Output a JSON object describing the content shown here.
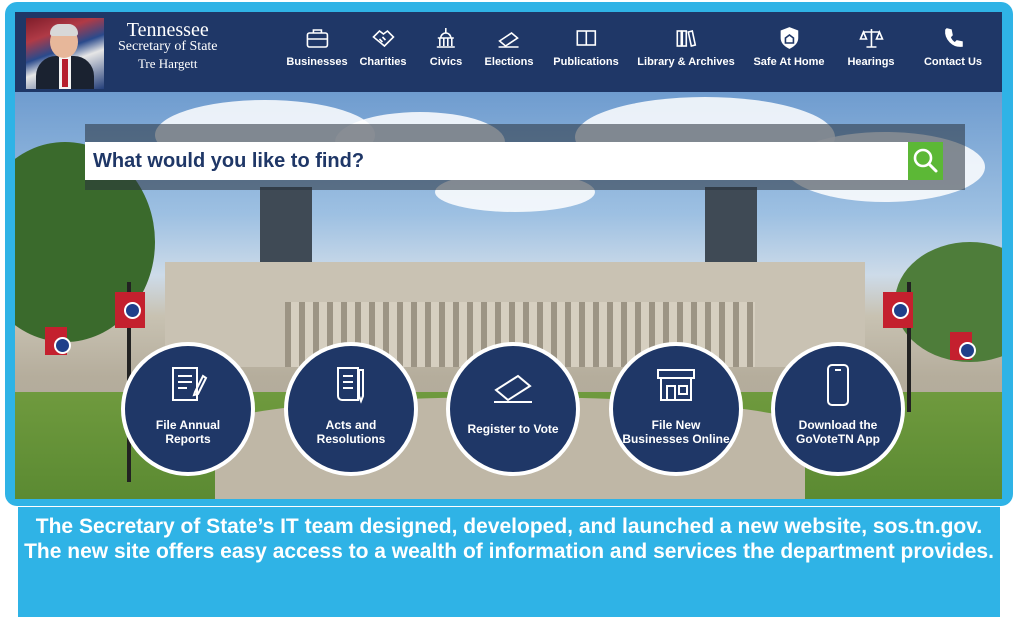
{
  "colors": {
    "navy": "#1f3767",
    "frame_blue": "#2fb3e6",
    "search_green": "#5cb836",
    "white": "#ffffff"
  },
  "header": {
    "title": "Tennessee",
    "subtitle": "Secretary of State",
    "name": "Tre Hargett",
    "nav": [
      {
        "label": "Businesses",
        "icon": "briefcase-icon"
      },
      {
        "label": "Charities",
        "icon": "handshake-icon"
      },
      {
        "label": "Civics",
        "icon": "capitol-icon"
      },
      {
        "label": "Elections",
        "icon": "vote-ballot-icon"
      },
      {
        "label": "Publications",
        "icon": "book-icon"
      },
      {
        "label": "Library & Archives",
        "icon": "books-icon"
      },
      {
        "label": "Safe At Home",
        "icon": "shield-icon"
      },
      {
        "label": "Hearings",
        "icon": "scales-icon"
      },
      {
        "label": "Contact Us",
        "icon": "phone-icon"
      }
    ]
  },
  "search": {
    "placeholder": "What would you like to find?",
    "button_icon": "search-icon"
  },
  "tiles": [
    {
      "label": "File Annual Reports",
      "icon": "document-pen-icon"
    },
    {
      "label": "Acts and Resolutions",
      "icon": "scroll-pen-icon"
    },
    {
      "label": "Register to Vote",
      "icon": "vote-ballot-icon"
    },
    {
      "label": "File New Businesses Online",
      "icon": "storefront-icon"
    },
    {
      "label": "Download the GoVoteTN App",
      "icon": "smartphone-icon"
    }
  ],
  "caption": {
    "text": "The Secretary of State’s IT team designed, developed, and launched a new website, sos.tn.gov. The new site offers easy access to a wealth of information and services the department provides."
  }
}
